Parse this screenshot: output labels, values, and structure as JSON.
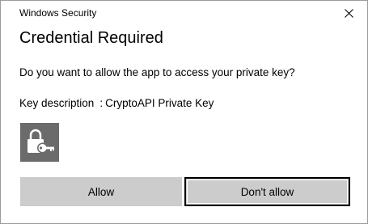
{
  "window": {
    "title": "Windows Security",
    "close_icon": "close-icon"
  },
  "dialog": {
    "heading": "Credential Required",
    "question": "Do you want to allow the app to access your private key?",
    "key_description": {
      "label": "Key description",
      "separator": ":",
      "value": "CryptoAPI Private Key"
    },
    "icon": "lock-key-icon",
    "icon_tile_color": "#6b6b6b"
  },
  "buttons": {
    "allow_label": "Allow",
    "deny_label": "Don't allow"
  },
  "colors": {
    "button_bg": "#cccccc",
    "focus_border": "#000000"
  }
}
